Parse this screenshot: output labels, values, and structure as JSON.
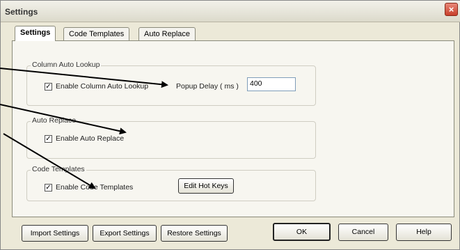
{
  "window": {
    "title": "Settings",
    "close_glyph": "×"
  },
  "tabs": [
    {
      "label": "Settings"
    },
    {
      "label": "Code Templates"
    },
    {
      "label": "Auto Replace"
    }
  ],
  "groups": {
    "column_auto_lookup": {
      "title": "Column Auto Lookup",
      "checkbox_label": "Enable Column Auto Lookup",
      "checked": true,
      "popup_delay_label": "Popup Delay ( ms )",
      "popup_delay_value": "400"
    },
    "auto_replace": {
      "title": "Auto Replace",
      "checkbox_label": "Enable Auto Replace",
      "checked": true
    },
    "code_templates": {
      "title": "Code Templates",
      "checkbox_label": "Enable Code Templates",
      "checked": true,
      "edit_hot_keys_label": "Edit Hot Keys"
    }
  },
  "footer": {
    "import_label": "Import Settings",
    "export_label": "Export Settings",
    "restore_label": "Restore Settings",
    "ok_label": "OK",
    "cancel_label": "Cancel",
    "help_label": "Help"
  },
  "check_glyph": "✓"
}
